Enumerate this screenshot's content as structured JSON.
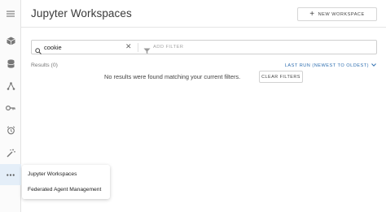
{
  "sidebar": {
    "icons": [
      "menu-icon",
      "workspaces-icon",
      "database-icon",
      "nodes-icon",
      "key-icon",
      "alarm-icon",
      "wand-icon",
      "more-icon"
    ]
  },
  "header": {
    "title": "Jupyter Workspaces",
    "new_workspace_label": "NEW WORKSPACE"
  },
  "search": {
    "value": "cookie",
    "add_filter_label": "ADD FILTER"
  },
  "results": {
    "count_label": "Results (0)",
    "sort_label": "LAST RUN (NEWEST TO OLDEST)",
    "empty_message": "No results were found matching your current filters.",
    "clear_filters_label": "CLEAR FILTERS"
  },
  "popup_menu": {
    "items": [
      "Jupyter Workspaces",
      "Federated Agent Management"
    ]
  },
  "colors": {
    "accent": "#2f6fb0",
    "active_nav_bg": "#e4eef8"
  }
}
